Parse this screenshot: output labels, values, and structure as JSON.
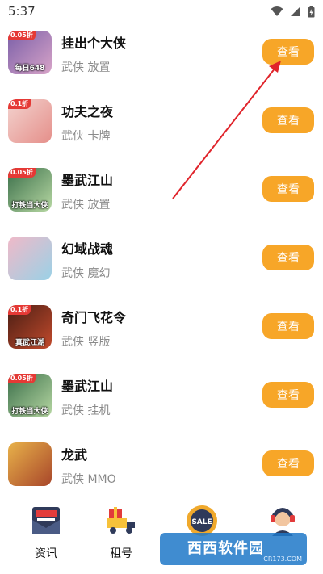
{
  "status_bar": {
    "time": "5:37"
  },
  "action_label": "查看",
  "games": [
    {
      "title": "挂出个大侠",
      "tags": "武侠 放置",
      "badge": "0.05折",
      "caption": "每日648",
      "colors": [
        "#7a5fa8",
        "#d8a4c8"
      ]
    },
    {
      "title": "功夫之夜",
      "tags": "武侠 卡牌",
      "badge": "0.1折",
      "caption": "",
      "colors": [
        "#f3d3cf",
        "#e58f8a"
      ]
    },
    {
      "title": "墨武江山",
      "tags": "武侠 放置",
      "badge": "0.05折",
      "caption": "打铁当大侠",
      "colors": [
        "#3b6f4a",
        "#b7d8a3"
      ]
    },
    {
      "title": "幻域战魂",
      "tags": "武侠 魔幻",
      "badge": "",
      "caption": "",
      "colors": [
        "#f0b9c8",
        "#9ad1e6"
      ]
    },
    {
      "title": "奇门飞花令",
      "tags": "武侠 竖版",
      "badge": "0.1折",
      "caption": "真武江湖",
      "colors": [
        "#4a1e14",
        "#c24a2c"
      ]
    },
    {
      "title": "墨武江山",
      "tags": "武侠 挂机",
      "badge": "0.05折",
      "caption": "打铁当大侠",
      "colors": [
        "#3b6f4a",
        "#b7d8a3"
      ]
    },
    {
      "title": "龙武",
      "tags": "武侠 MMO",
      "badge": "",
      "caption": "",
      "colors": [
        "#e8b24a",
        "#a8462a"
      ]
    }
  ],
  "bottom_nav": [
    {
      "label": "资讯",
      "icon": "news-icon"
    },
    {
      "label": "租号",
      "icon": "gift-truck-icon"
    },
    {
      "label": "",
      "icon": "sale-badge-icon"
    },
    {
      "label": "",
      "icon": "customer-service-icon"
    }
  ],
  "watermark": {
    "text": "西西软件园",
    "sub": "CR173.COM"
  }
}
